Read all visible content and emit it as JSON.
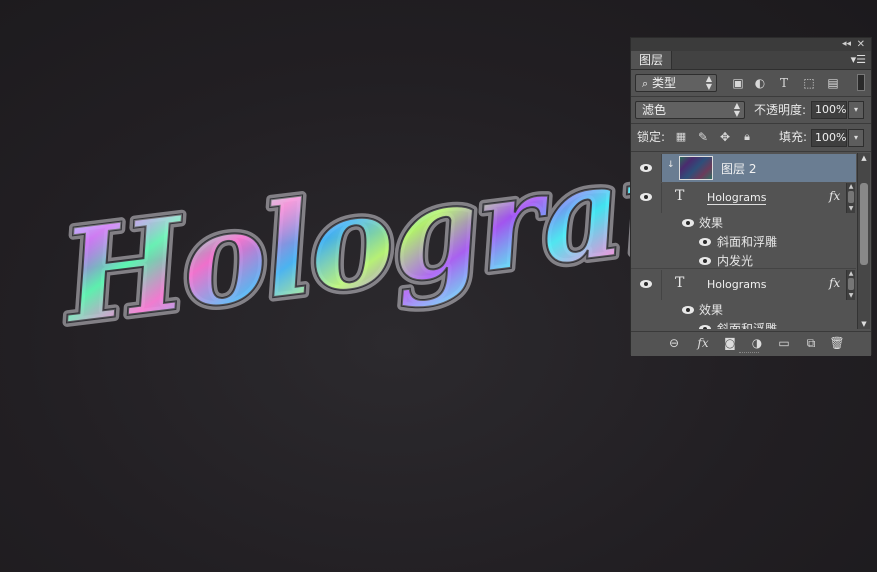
{
  "canvas": {
    "artwork_text": "Holograms",
    "colors": {
      "background": "#221f23",
      "outline": "#b8b6bd",
      "holo_1": "#39d6ff",
      "holo_2": "#c24bff",
      "holo_3": "#6cff7a",
      "holo_4": "#ff6bd0"
    }
  },
  "panel": {
    "tab_label": "图层",
    "filter": {
      "kind_label": "类型"
    },
    "blend_mode": "滤色",
    "opacity_label": "不透明度:",
    "opacity_value": "100%",
    "lock_label": "锁定:",
    "fill_label": "填充:",
    "fill_value": "100%",
    "layers": [
      {
        "name": "图层 2",
        "type": "pixel",
        "selected": true
      },
      {
        "name": "Holograms",
        "type": "text",
        "effects_label": "效果",
        "effects": [
          "斜面和浮雕",
          "内发光"
        ]
      },
      {
        "name": "Holograms",
        "type": "text",
        "effects_label": "效果",
        "effects": [
          "斜面和浮雕"
        ]
      }
    ],
    "icons": {
      "title_bar": [
        "collapse-icon",
        "close-icon",
        "panel-menu-icon"
      ],
      "filter": [
        "search-icon",
        "pixel-filter-icon",
        "adjustment-filter-icon",
        "type-filter-icon",
        "shape-filter-icon",
        "smart-object-filter-icon"
      ],
      "lock": [
        "lock-transparent-icon",
        "lock-paint-icon",
        "lock-move-icon",
        "lock-all-icon"
      ],
      "footer": [
        "link-icon",
        "fx-icon",
        "mask-icon",
        "adjustment-icon",
        "group-icon",
        "new-layer-icon",
        "delete-icon"
      ]
    }
  }
}
